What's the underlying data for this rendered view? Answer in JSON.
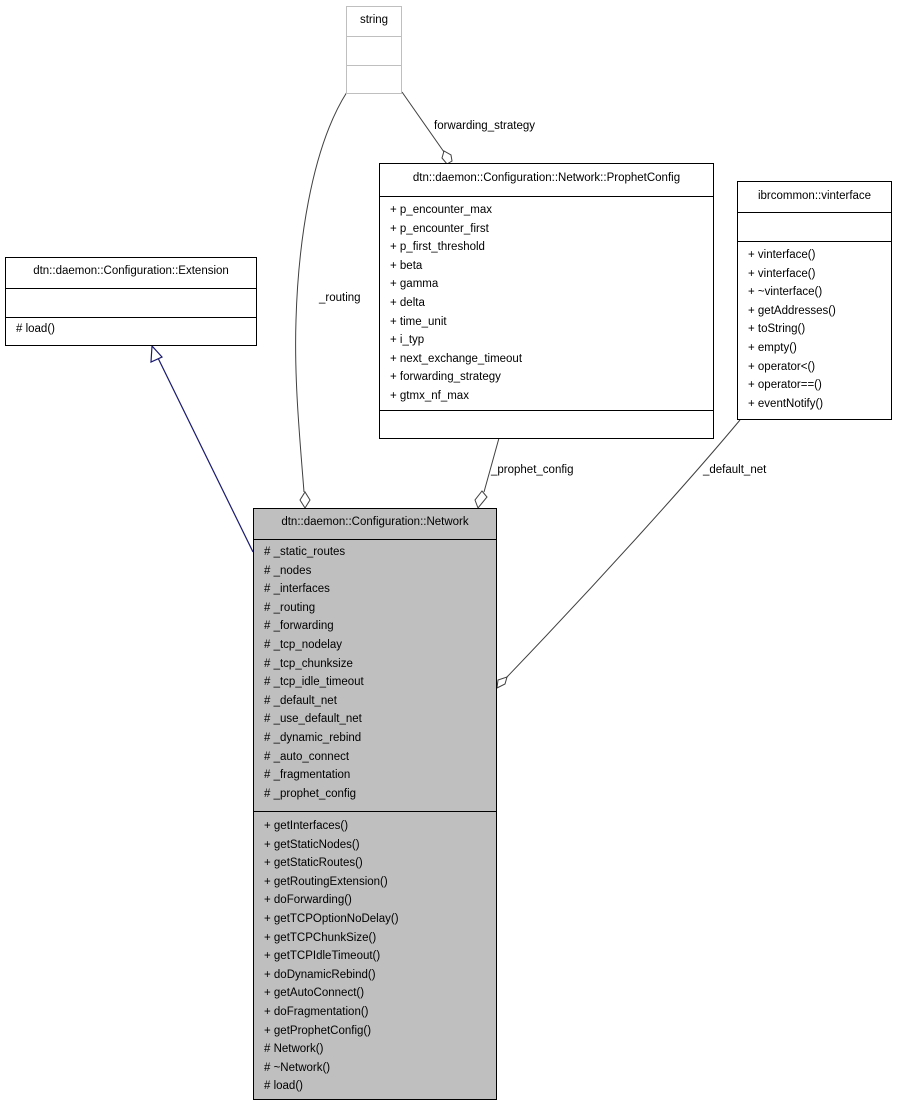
{
  "classes": {
    "string": {
      "name": "string",
      "attributes": [],
      "methods": []
    },
    "prophet_config": {
      "name": "dtn::daemon::Configuration::Network::ProphetConfig",
      "attributes": [
        "+ p_encounter_max",
        "+ p_encounter_first",
        "+ p_first_threshold",
        "+ beta",
        "+ gamma",
        "+ delta",
        "+ time_unit",
        "+ i_typ",
        "+ next_exchange_timeout",
        "+ forwarding_strategy",
        "+ gtmx_nf_max"
      ],
      "methods": []
    },
    "vinterface": {
      "name": "ibrcommon::vinterface",
      "attributes": [],
      "methods": [
        "+ vinterface()",
        "+ vinterface()",
        "+ ~vinterface()",
        "+ getAddresses()",
        "+ toString()",
        "+ empty()",
        "+ operator<()",
        "+ operator==()",
        "+ eventNotify()"
      ]
    },
    "extension": {
      "name": "dtn::daemon::Configuration::Extension",
      "attributes": [],
      "methods": [
        "# load()"
      ]
    },
    "network": {
      "name": "dtn::daemon::Configuration::Network",
      "attributes": [
        "# _static_routes",
        "# _nodes",
        "# _interfaces",
        "# _routing",
        "# _forwarding",
        "# _tcp_nodelay",
        "# _tcp_chunksize",
        "# _tcp_idle_timeout",
        "# _default_net",
        "# _use_default_net",
        "# _dynamic_rebind",
        "# _auto_connect",
        "# _fragmentation",
        "# _prophet_config"
      ],
      "methods": [
        "+ getInterfaces()",
        "+ getStaticNodes()",
        "+ getStaticRoutes()",
        "+ getRoutingExtension()",
        "+ doForwarding()",
        "+ getTCPOptionNoDelay()",
        "+ getTCPChunkSize()",
        "+ getTCPIdleTimeout()",
        "+ doDynamicRebind()",
        "+ getAutoConnect()",
        "+ doFragmentation()",
        "+ getProphetConfig()",
        "# Network()",
        "# ~Network()",
        "# load()"
      ]
    }
  },
  "edges": {
    "forwarding_strategy": "forwarding_strategy",
    "routing": "_routing",
    "prophet_config": "_prophet_config",
    "default_net": "_default_net"
  },
  "colors": {
    "inheritance": "#191970",
    "association": "#404040",
    "focus_fill": "#bfbfbf"
  }
}
